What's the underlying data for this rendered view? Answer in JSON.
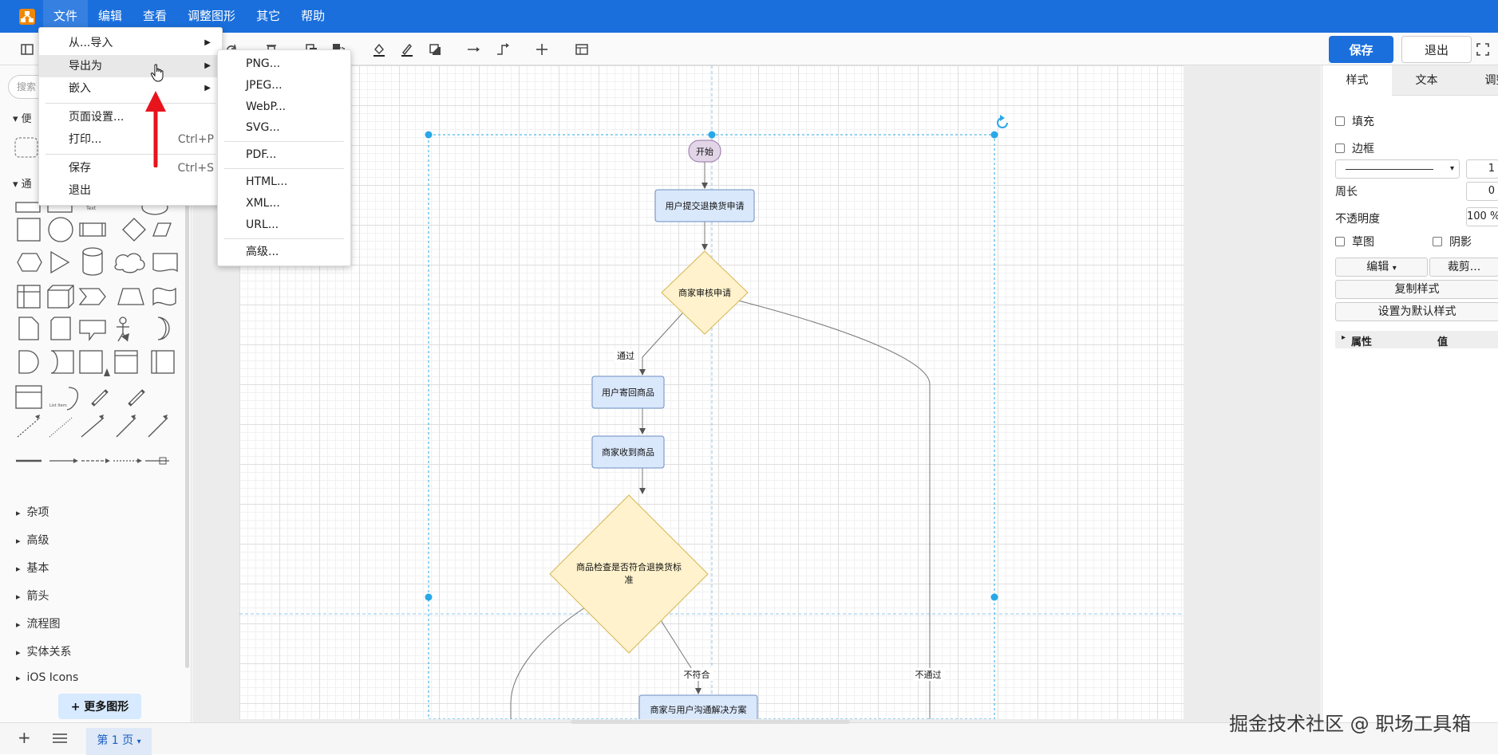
{
  "menubar": {
    "items": [
      "文件",
      "编辑",
      "查看",
      "调整图形",
      "其它",
      "帮助"
    ]
  },
  "toolbar": {
    "save_label": "保存",
    "exit_label": "退出"
  },
  "file_menu": {
    "items": [
      {
        "label": "从...导入",
        "submenu": true
      },
      {
        "label": "导出为",
        "submenu": true,
        "highlighted": true
      },
      {
        "label": "嵌入",
        "submenu": true
      },
      {
        "label": "页面设置...",
        "shortcut": ""
      },
      {
        "label": "打印...",
        "shortcut": "Ctrl+P"
      },
      {
        "label": "保存",
        "shortcut": "Ctrl+S"
      },
      {
        "label": "退出",
        "shortcut": ""
      }
    ]
  },
  "export_menu": {
    "items": [
      "PNG...",
      "JPEG...",
      "WebP...",
      "SVG...",
      "PDF...",
      "HTML...",
      "XML...",
      "URL...",
      "高级..."
    ]
  },
  "sidebar": {
    "search_placeholder": "搜索",
    "section_favorites": "便",
    "section_general": "通",
    "shape_text_label": "Text",
    "shape_list_label": "List Item",
    "categories": [
      "杂项",
      "高级",
      "基本",
      "箭头",
      "流程图",
      "实体关系",
      "iOS Icons"
    ],
    "more_shapes": "+ 更多图形"
  },
  "diagram": {
    "nodes": {
      "start": "开始",
      "submit": "用户提交退换货申请",
      "review": "商家审核申请",
      "send_back": "用户寄回商品",
      "received": "商家收到商品",
      "inspect_line1": "商品检查是否符合退换货标",
      "inspect_line2": "准",
      "negotiate": "商家与用户沟通解决方案"
    },
    "edges": {
      "pass": "通过",
      "not_match": "不符合",
      "not_pass": "不通过"
    }
  },
  "right_panel": {
    "tabs": [
      "样式",
      "文本",
      "调整"
    ],
    "fill": "填充",
    "border": "边框",
    "border_width": "1",
    "perimeter_label": "周长",
    "perimeter_value": "0",
    "opacity_label": "不透明度",
    "opacity_value": "100 %",
    "sketch": "草图",
    "shadow": "阴影",
    "edit_btn": "编辑",
    "crop_btn": "裁剪...",
    "copy_style": "复制样式",
    "set_default": "设置为默认样式",
    "prop_label": "属性",
    "value_label": "值"
  },
  "bottom": {
    "page_tab": "第 1 页"
  },
  "watermark": "掘金技术社区 @ 职场工具箱",
  "colors": {
    "brand": "#1a6fdc",
    "selection": "#29a8e8",
    "process_fill": "#dae8fc",
    "process_stroke": "#6c8ebf",
    "decision_fill": "#fff2cc",
    "decision_stroke": "#d6b656",
    "start_fill": "#e1d5e7",
    "start_stroke": "#9673a6",
    "red_arrow": "#e8141c"
  }
}
